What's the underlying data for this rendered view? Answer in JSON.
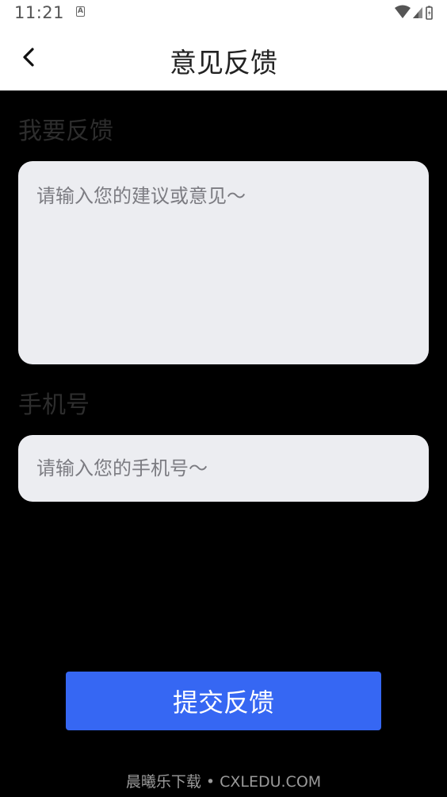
{
  "status_bar": {
    "time": "11:21",
    "notification_letter": "A"
  },
  "header": {
    "title": "意见反馈",
    "back_icon": "chevron-left-icon"
  },
  "feedback_section": {
    "label": "我要反馈",
    "placeholder": "请输入您的建议或意见～"
  },
  "phone_section": {
    "label": "手机号",
    "placeholder": "请输入您的手机号～"
  },
  "submit": {
    "label": "提交反馈",
    "color": "#3667f3"
  },
  "watermark": {
    "text": "晨曦乐下载 • CXLEDU.COM"
  }
}
